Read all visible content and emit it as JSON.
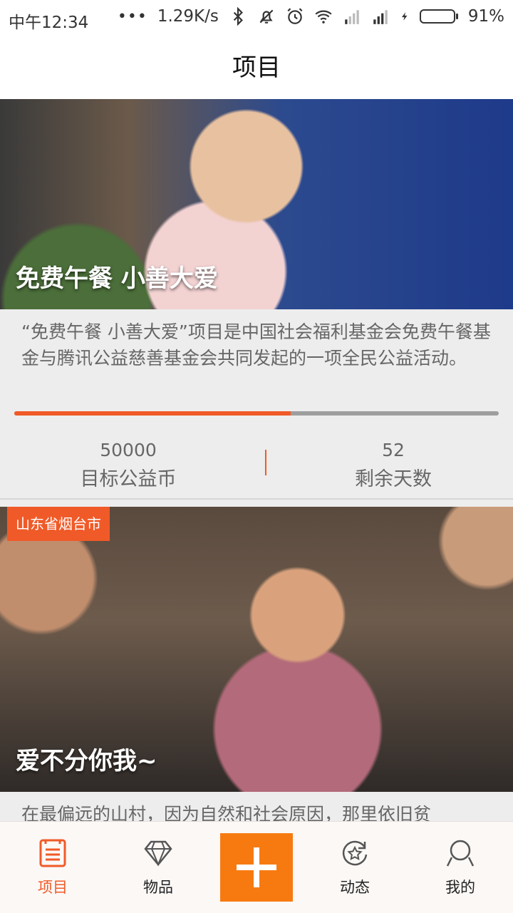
{
  "status_bar": {
    "time": "中午12:34",
    "net_speed": "1.29K/s",
    "battery_percent": "91%",
    "battery_level": 0.91
  },
  "header": {
    "title": "项目"
  },
  "projects": [
    {
      "title": "免费午餐 小善大爱",
      "description": "“免费午餐 小善大爱”项目是中国社会福利基金会免费午餐基金与腾讯公益慈善基金会共同发起的一项全民公益活动。",
      "progress": 0.57,
      "target_value": "50000",
      "target_label": "目标公益币",
      "days_value": "52",
      "days_label": "剩余天数"
    },
    {
      "location_tag": "山东省烟台市",
      "title": "爱不分你我~",
      "description": "在最偏远的山村，因为自然和社会原因，那里依旧贫"
    }
  ],
  "bottom_nav": {
    "items": [
      {
        "label": "项目",
        "icon": "project-list-icon",
        "active": true
      },
      {
        "label": "物品",
        "icon": "diamond-icon",
        "active": false
      },
      {
        "label": "",
        "icon": "plus-icon",
        "active": false
      },
      {
        "label": "动态",
        "icon": "refresh-star-icon",
        "active": false
      },
      {
        "label": "我的",
        "icon": "user-icon",
        "active": false
      }
    ]
  },
  "colors": {
    "accent": "#f05a28",
    "add_button": "#f77a11",
    "progress_track": "#9e9e9e",
    "battery_fill": "#3fb93f"
  }
}
